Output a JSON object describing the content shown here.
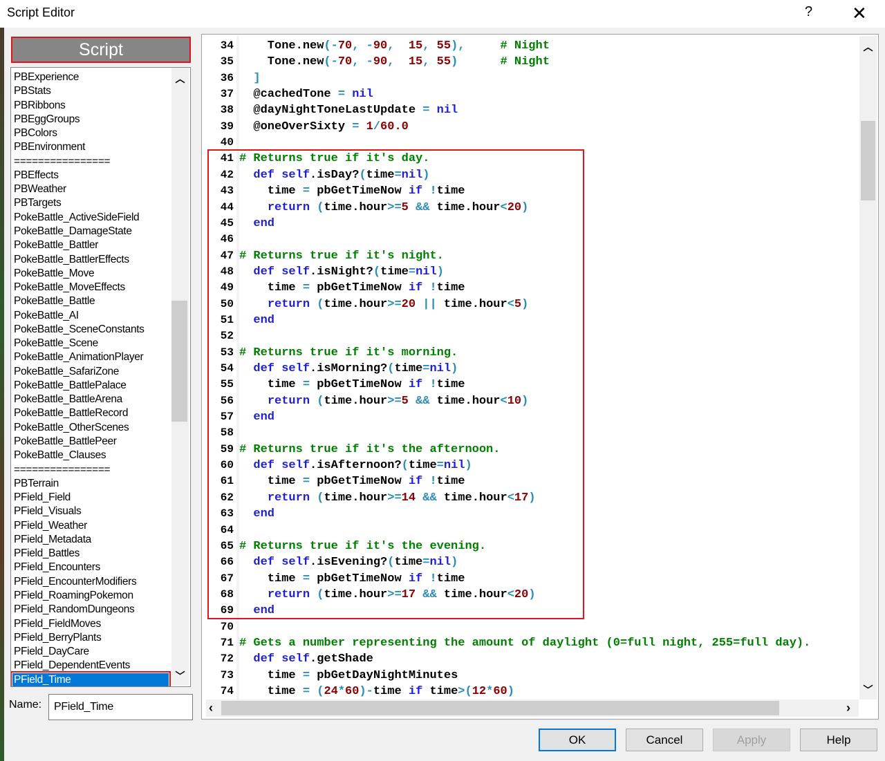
{
  "window": {
    "title": "Script Editor",
    "help": "?",
    "close": "✕"
  },
  "sidebar": {
    "header_button": "Script",
    "selected_index": 43,
    "items": [
      "PBExperience",
      "PBStats",
      "PBRibbons",
      "PBEggGroups",
      "PBColors",
      "PBEnvironment",
      "================",
      "PBEffects",
      "PBWeather",
      "PBTargets",
      "PokeBattle_ActiveSideField",
      "PokeBattle_DamageState",
      "PokeBattle_Battler",
      "PokeBattle_BattlerEffects",
      "PokeBattle_Move",
      "PokeBattle_MoveEffects",
      "PokeBattle_Battle",
      "PokeBattle_AI",
      "PokeBattle_SceneConstants",
      "PokeBattle_Scene",
      "PokeBattle_AnimationPlayer",
      "PokeBattle_SafariZone",
      "PokeBattle_BattlePalace",
      "PokeBattle_BattleArena",
      "PokeBattle_BattleRecord",
      "PokeBattle_OtherScenes",
      "PokeBattle_BattlePeer",
      "PokeBattle_Clauses",
      "================",
      "PBTerrain",
      "PField_Field",
      "PField_Visuals",
      "PField_Weather",
      "PField_Metadata",
      "PField_Battles",
      "PField_Encounters",
      "PField_EncounterModifiers",
      "PField_RoamingPokemon",
      "PField_RandomDungeons",
      "PField_FieldMoves",
      "PField_BerryPlants",
      "PField_DayCare",
      "PField_DependentEvents",
      "PField_Time"
    ],
    "name_label": "Name:",
    "name_value": "PField_Time"
  },
  "editor": {
    "lines": [
      {
        "n": "34",
        "text": "    Tone.new(-70, -90,  15, 55),     # Night"
      },
      {
        "n": "35",
        "text": "    Tone.new(-70, -90,  15, 55)      # Night"
      },
      {
        "n": "36",
        "text": "  ]"
      },
      {
        "n": "37",
        "text": "  @cachedTone = nil"
      },
      {
        "n": "38",
        "text": "  @dayNightToneLastUpdate = nil"
      },
      {
        "n": "39",
        "text": "  @oneOverSixty = 1/60.0"
      },
      {
        "n": "40",
        "text": ""
      },
      {
        "n": "41",
        "text": "# Returns true if it's day."
      },
      {
        "n": "42",
        "text": "  def self.isDay?(time=nil)"
      },
      {
        "n": "43",
        "text": "    time = pbGetTimeNow if !time"
      },
      {
        "n": "44",
        "text": "    return (time.hour>=5 && time.hour<20)"
      },
      {
        "n": "45",
        "text": "  end"
      },
      {
        "n": "46",
        "text": ""
      },
      {
        "n": "47",
        "text": "# Returns true if it's night."
      },
      {
        "n": "48",
        "text": "  def self.isNight?(time=nil)"
      },
      {
        "n": "49",
        "text": "    time = pbGetTimeNow if !time"
      },
      {
        "n": "50",
        "text": "    return (time.hour>=20 || time.hour<5)"
      },
      {
        "n": "51",
        "text": "  end"
      },
      {
        "n": "52",
        "text": ""
      },
      {
        "n": "53",
        "text": "# Returns true if it's morning."
      },
      {
        "n": "54",
        "text": "  def self.isMorning?(time=nil)"
      },
      {
        "n": "55",
        "text": "    time = pbGetTimeNow if !time"
      },
      {
        "n": "56",
        "text": "    return (time.hour>=5 && time.hour<10)"
      },
      {
        "n": "57",
        "text": "  end"
      },
      {
        "n": "58",
        "text": ""
      },
      {
        "n": "59",
        "text": "# Returns true if it's the afternoon."
      },
      {
        "n": "60",
        "text": "  def self.isAfternoon?(time=nil)"
      },
      {
        "n": "61",
        "text": "    time = pbGetTimeNow if !time"
      },
      {
        "n": "62",
        "text": "    return (time.hour>=14 && time.hour<17)"
      },
      {
        "n": "63",
        "text": "  end"
      },
      {
        "n": "64",
        "text": ""
      },
      {
        "n": "65",
        "text": "# Returns true if it's the evening."
      },
      {
        "n": "66",
        "text": "  def self.isEvening?(time=nil)"
      },
      {
        "n": "67",
        "text": "    time = pbGetTimeNow if !time"
      },
      {
        "n": "68",
        "text": "    return (time.hour>=17 && time.hour<20)"
      },
      {
        "n": "69",
        "text": "  end"
      },
      {
        "n": "70",
        "text": ""
      },
      {
        "n": "71",
        "text": "# Gets a number representing the amount of daylight (0=full night, 255=full day)."
      },
      {
        "n": "72",
        "text": "  def self.getShade"
      },
      {
        "n": "73",
        "text": "    time = pbGetDayNightMinutes"
      },
      {
        "n": "74",
        "text": "    time = (24*60)-time if time>(12*60)"
      }
    ],
    "syntax_colors": {
      "comment": "#008000",
      "keyword": "#1f1fd8",
      "number": "#8b0000",
      "operator": "#2a8bb8"
    },
    "highlight_color": "#e0141e"
  },
  "buttons": {
    "ok": "OK",
    "cancel": "Cancel",
    "apply": "Apply",
    "help": "Help"
  }
}
